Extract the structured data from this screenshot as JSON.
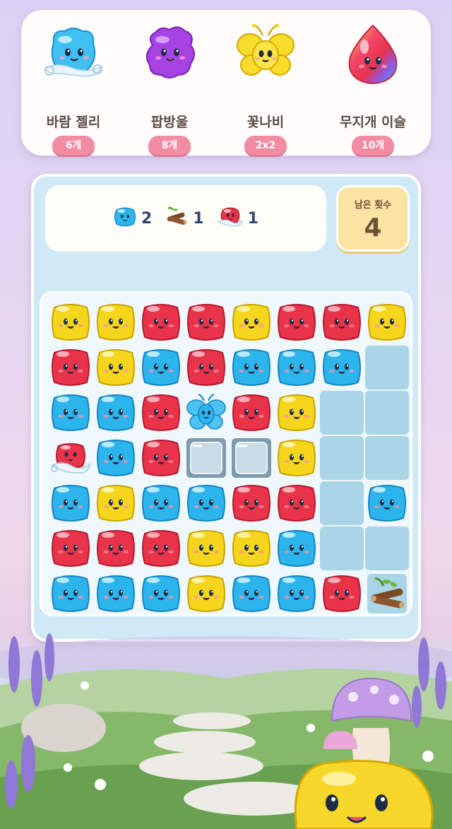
{
  "boosters": [
    {
      "name": "바람 젤리",
      "count": "6개",
      "icon": "wind-jelly-icon"
    },
    {
      "name": "팝방울",
      "count": "8개",
      "icon": "pop-bubble-icon"
    },
    {
      "name": "꽃나비",
      "count": "2x2",
      "icon": "flower-butterfly-icon"
    },
    {
      "name": "무지개 이슬",
      "count": "10개",
      "icon": "rainbow-dew-icon"
    }
  ],
  "goals": [
    {
      "icon": "blue-jelly-icon",
      "count": "2"
    },
    {
      "icon": "log-icon",
      "count": "1"
    },
    {
      "icon": "red-wind-jelly-icon",
      "count": "1"
    }
  ],
  "moves": {
    "label": "남은 횟수",
    "value": "4"
  },
  "colors": {
    "red": "#e83349",
    "yellow": "#f6d61c",
    "blue": "#2cb5ec",
    "empty": "#a9d5e6",
    "booster_badge": "#f28ca3"
  },
  "board": [
    [
      "Y",
      "Y",
      "R",
      "R",
      "Y",
      "R",
      "R",
      "Y"
    ],
    [
      "R",
      "Y",
      "B",
      "R",
      "B",
      "B",
      "B",
      "E"
    ],
    [
      "B",
      "B",
      "R",
      "BF",
      "R",
      "Y",
      "E",
      "E"
    ],
    [
      "RW",
      "B",
      "R",
      "I",
      "I",
      "Y",
      "E",
      "E"
    ],
    [
      "B",
      "Y",
      "B",
      "B",
      "R",
      "R",
      "E",
      "B"
    ],
    [
      "R",
      "R",
      "R",
      "Y",
      "Y",
      "B",
      "E",
      "E"
    ],
    [
      "B",
      "B",
      "B",
      "Y",
      "B",
      "B",
      "R",
      "L"
    ]
  ],
  "tile_legend": {
    "R": "red-jelly",
    "Y": "yellow-jelly",
    "B": "blue-jelly",
    "E": "empty-cell",
    "I": "ice-block",
    "BF": "blue-butterfly",
    "RW": "red-wind-jelly",
    "L": "log-obstacle"
  }
}
